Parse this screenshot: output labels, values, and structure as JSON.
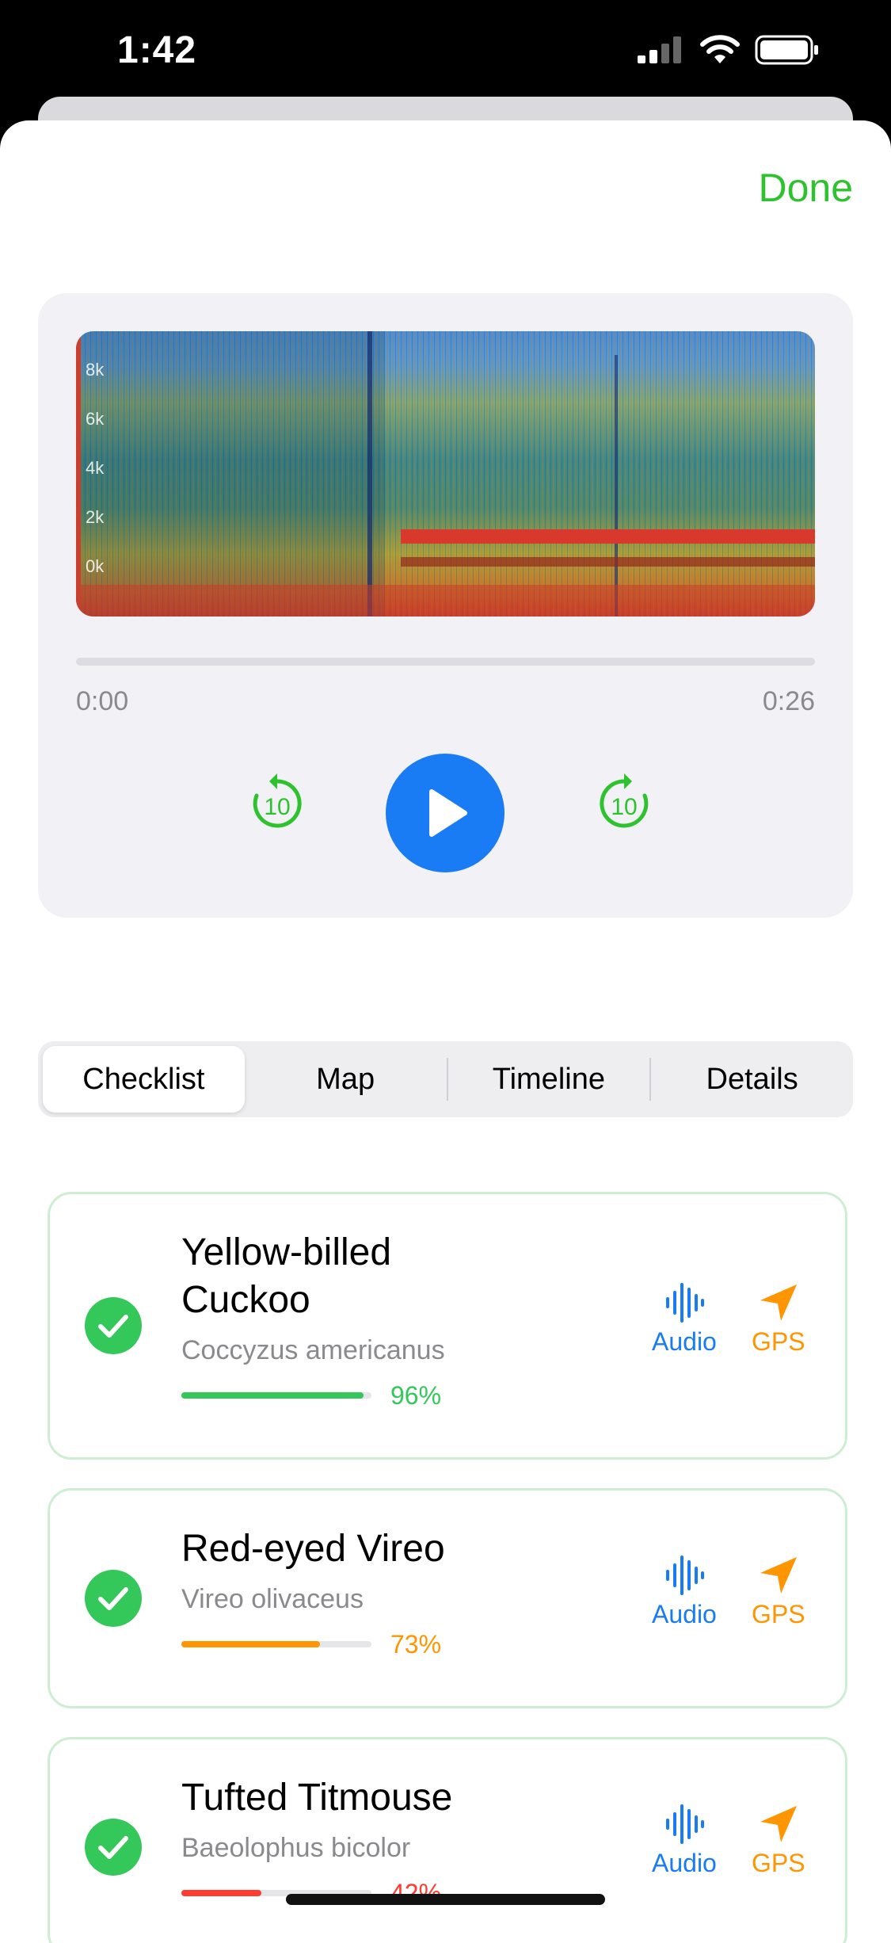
{
  "status_bar": {
    "time": "1:42"
  },
  "header": {
    "done_label": "Done"
  },
  "player": {
    "frequency_labels": [
      "8k",
      "6k",
      "4k",
      "2k",
      "0k"
    ],
    "time_start": "0:00",
    "time_end": "0:26",
    "skip_back_label": "10",
    "skip_forward_label": "10",
    "progress": 0
  },
  "tabs": [
    {
      "label": "Checklist",
      "active": true
    },
    {
      "label": "Map",
      "active": false
    },
    {
      "label": "Timeline",
      "active": false
    },
    {
      "label": "Details",
      "active": false
    }
  ],
  "species": [
    {
      "name_line1": "Yellow-billed",
      "name_line2": "Cuckoo",
      "latin": "Coccyzus americanus",
      "confidence": "96%",
      "confidence_value": 0.96,
      "color": "#34c759",
      "audio_label": "Audio",
      "gps_label": "GPS"
    },
    {
      "name_line1": "Red-eyed Vireo",
      "name_line2": "",
      "latin": "Vireo olivaceus",
      "confidence": "73%",
      "confidence_value": 0.73,
      "color": "#ff9500",
      "audio_label": "Audio",
      "gps_label": "GPS"
    },
    {
      "name_line1": "Tufted Titmouse",
      "name_line2": "",
      "latin": "Baeolophus bicolor",
      "confidence": "42%",
      "confidence_value": 0.42,
      "color": "#ff3b30",
      "audio_label": "Audio",
      "gps_label": "GPS"
    }
  ],
  "colors": {
    "accent_green": "#2fc22f",
    "accent_blue": "#1a7cf5",
    "accent_orange": "#ff9500"
  }
}
